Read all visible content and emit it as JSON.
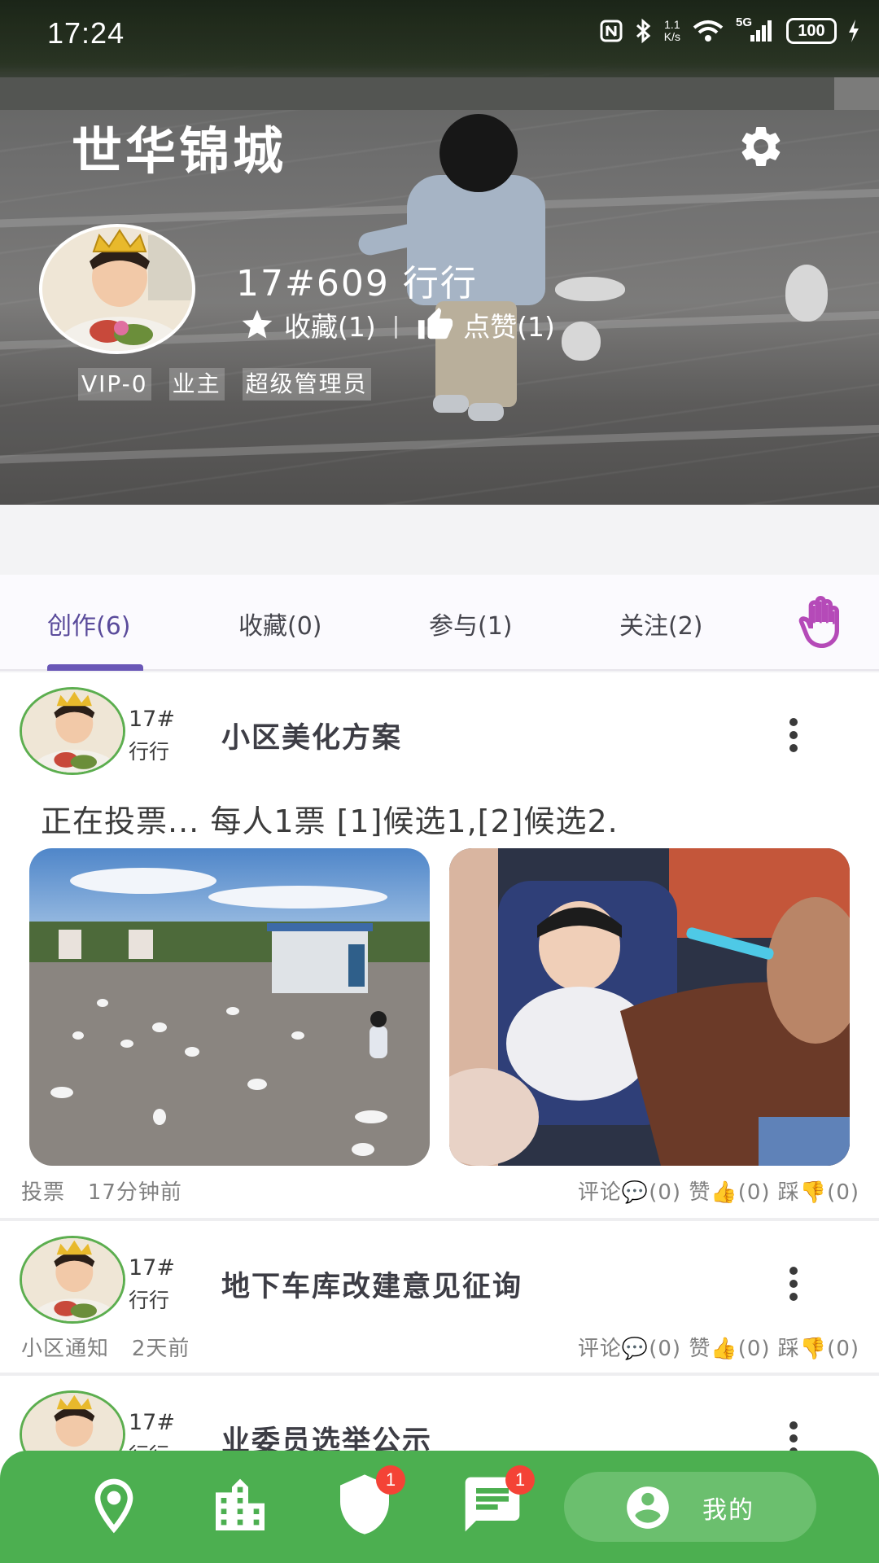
{
  "status_bar": {
    "time": "17:24",
    "net_speed_top": "1.1",
    "net_speed_bottom": "K/s",
    "signal_label": "5G",
    "battery": "100",
    "icons": [
      "nfc-icon",
      "bluetooth-icon",
      "wifi-icon",
      "signal-icon",
      "charging-icon"
    ]
  },
  "header": {
    "community_name": "世华锦城",
    "settings_icon": "gear-icon"
  },
  "profile": {
    "name": "17#609 行行",
    "favorites_label": "收藏(1)",
    "likes_label": "点赞(1)",
    "separator": "|",
    "badges": [
      "VIP-0",
      "业主",
      "超级管理员"
    ]
  },
  "tabs": {
    "items": [
      {
        "label": "创作(6)",
        "active": true
      },
      {
        "label": "收藏(0)",
        "active": false
      },
      {
        "label": "参与(1)",
        "active": false
      },
      {
        "label": "关注(2)",
        "active": false
      }
    ],
    "hand_icon": "raised-hand-icon",
    "accent_color": "#6a57b7"
  },
  "posts": [
    {
      "author_line1": "17#",
      "author_line2": "行行",
      "title": "小区美化方案",
      "summary": "正在投票...  每人1票 [1]候选1,[2]候选2.",
      "images": [
        "plaza-doves-photo",
        "car-seat-photo"
      ],
      "category": "投票",
      "time": "17分钟前",
      "comments": "评论💬(0)",
      "likes": "赞👍(0)",
      "dislikes": "踩👎(0)"
    },
    {
      "author_line1": "17#",
      "author_line2": "行行",
      "title": "地下车库改建意见征询",
      "category": "小区通知",
      "time": "2天前",
      "comments": "评论💬(0)",
      "likes": "赞👍(0)",
      "dislikes": "踩👎(0)"
    },
    {
      "author_line1": "17#",
      "author_line2": "行行",
      "title": "业委员选举公示"
    }
  ],
  "bottom_nav": {
    "items": [
      {
        "icon": "location-pin-icon"
      },
      {
        "icon": "building-icon"
      },
      {
        "icon": "shield-icon",
        "badge": "1"
      },
      {
        "icon": "message-icon",
        "badge": "1"
      }
    ],
    "mine_label": "我的",
    "mine_icon": "account-circle-icon",
    "color": "#4caf50"
  }
}
